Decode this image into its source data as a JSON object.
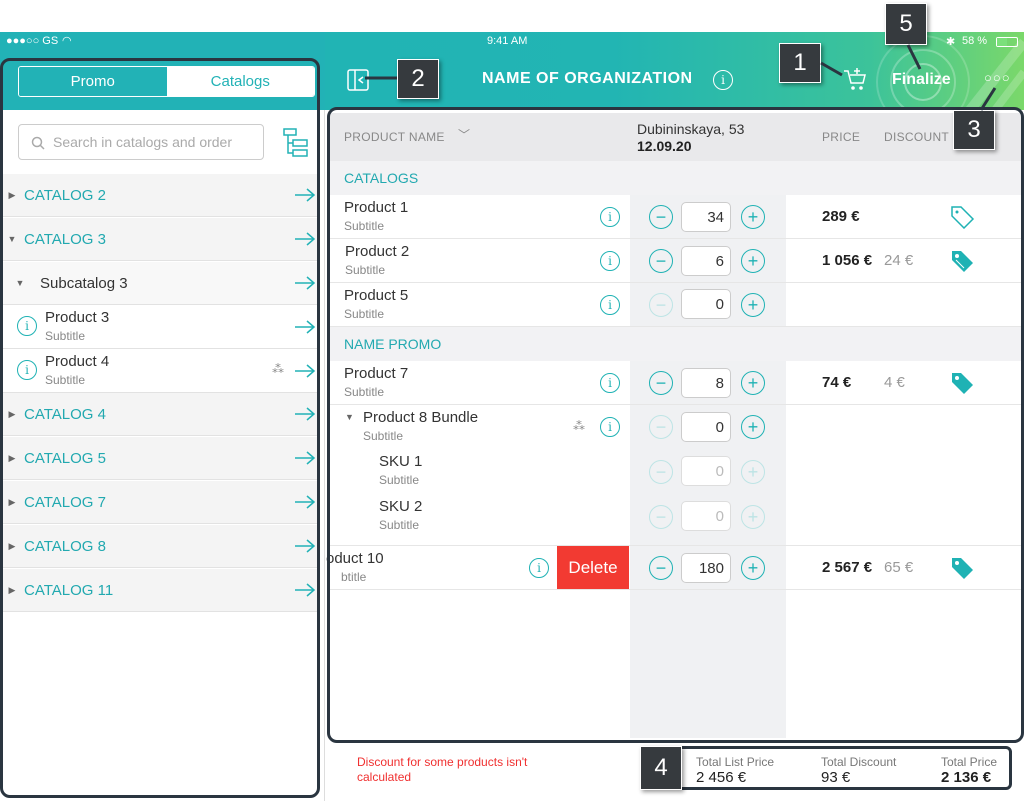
{
  "status_bar": {
    "carrier": "●●●○○ GS",
    "time": "9:41 AM",
    "battery": "58 %"
  },
  "sidebar": {
    "tabs": [
      {
        "label": "Promo",
        "active": true
      },
      {
        "label": "Catalogs",
        "active": false
      }
    ],
    "search_placeholder": "Search in catalogs and order",
    "catalogs": [
      {
        "label": "CATALOG 2"
      },
      {
        "label": "CATALOG 3"
      },
      {
        "label": "CATALOG 4"
      },
      {
        "label": "CATALOG 5"
      },
      {
        "label": "CATALOG 7"
      },
      {
        "label": "CATALOG 8"
      },
      {
        "label": "CATALOG 11"
      }
    ],
    "subcatalog": "Subcatalog 3",
    "products": [
      {
        "name": "Product 3",
        "subtitle": "Subtitle"
      },
      {
        "name": "Product 4",
        "subtitle": "Subtitle"
      }
    ]
  },
  "header": {
    "title": "NAME OF ORGANIZATION",
    "finalize": "Finalize"
  },
  "table": {
    "col_product": "PRODUCT NAME",
    "store": "Dubininskaya, 53",
    "date": "12.09.20",
    "col_price": "PRICE",
    "col_discount": "DISCOUNT",
    "sections": [
      "CATALOGS",
      "NAME PROMO"
    ],
    "rows": [
      {
        "name": "Product 1",
        "subtitle": "Subtitle",
        "qty": "34",
        "price": "289 €",
        "discount": ""
      },
      {
        "name": "Product 2",
        "subtitle": "Subtitle",
        "qty": "6",
        "price": "1 056 €",
        "discount": "24 €"
      },
      {
        "name": "Product 5",
        "subtitle": "Subtitle",
        "qty": "0",
        "price": "",
        "discount": ""
      },
      {
        "name": "Product 7",
        "subtitle": "Subtitle",
        "qty": "8",
        "price": "74 €",
        "discount": "4 €"
      },
      {
        "name": "Product 8 Bundle",
        "subtitle": "Subtitle",
        "qty": "0",
        "price": "",
        "discount": ""
      },
      {
        "name": "SKU 1",
        "subtitle": "Subtitle",
        "qty": "0",
        "price": "",
        "discount": ""
      },
      {
        "name": "SKU 2",
        "subtitle": "Subtitle",
        "qty": "0",
        "price": "",
        "discount": ""
      },
      {
        "name": "oduct 10",
        "subtitle": "btitle",
        "qty": "180",
        "price": "2 567 €",
        "discount": "65 €"
      }
    ],
    "delete_label": "Delete"
  },
  "footer": {
    "warning": "Discount for some products isn't calculated",
    "total_list_label": "Total List Price",
    "total_list_value": "2 456 €",
    "total_discount_label": "Total Discount",
    "total_discount_value": "93 €",
    "total_price_label": "Total Price",
    "total_price_value": "2 136 €"
  },
  "annotations": [
    "1",
    "2",
    "3",
    "4",
    "5"
  ],
  "colors": {
    "accent": "#22b2b6",
    "delete": "#f23a32",
    "annotation": "#363a3e"
  }
}
